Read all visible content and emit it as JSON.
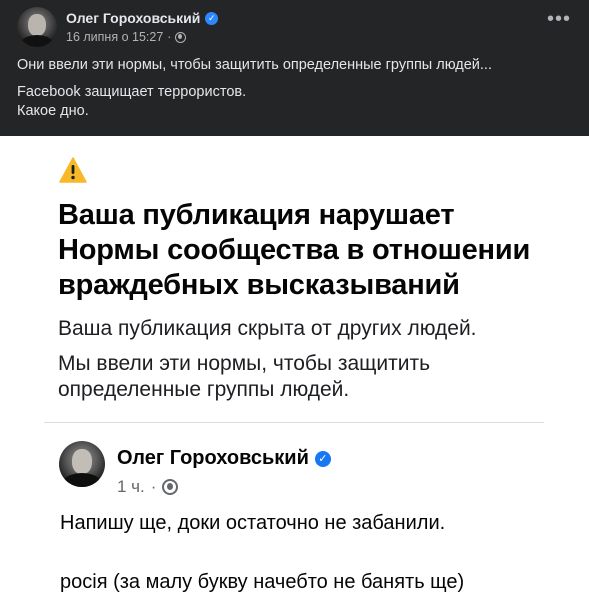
{
  "post": {
    "author": "Олег Гороховський",
    "timestamp": "16 липня о 15:27",
    "meta_separator": "·",
    "privacy_icon": "globe-icon",
    "more_icon": "more-dots-icon",
    "text_line1": "Они ввели эти нормы, чтобы защитить определенные группы людей...",
    "text_line2": "Facebook защищает террористов.",
    "text_line3": "Какое дно."
  },
  "screenshot": {
    "warning_icon": "warning-triangle-icon",
    "title": "Ваша публикация нарушает Нормы сообщества в отношении враждебных высказываний",
    "line1": "Ваша публикация скрыта от других людей.",
    "line2": "Мы ввели эти нормы, чтобы защитить определенные группы людей.",
    "original_post": {
      "author": "Олег Гороховський",
      "time": "1 ч.",
      "meta_separator": "·",
      "privacy_icon": "globe-icon",
      "text_line1": "Напишу ще, доки остаточно не забанили.",
      "text_line2": "росія (за малу букву начебто не банять ще)"
    }
  },
  "colors": {
    "dark_bg": "#242526",
    "dark_text": "#e4e6eb",
    "verified_badge": "#1877f2",
    "warning_yellow": "#f7b928"
  }
}
